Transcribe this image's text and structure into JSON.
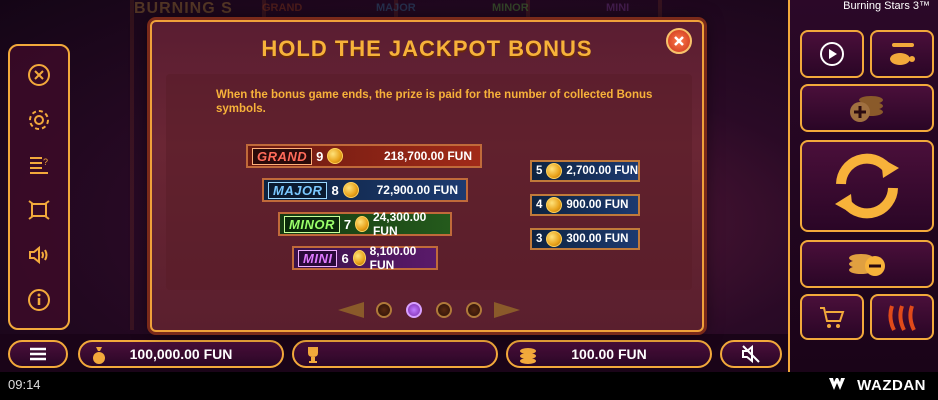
{
  "app": {
    "title": "Burning Stars 3™",
    "brand": "WAZDAN",
    "clock": "09:14"
  },
  "background": {
    "logo": "BURNING S",
    "tags": [
      "GRAND",
      "MAJOR",
      "MINOR",
      "MINI"
    ]
  },
  "modal": {
    "title": "HOLD THE JACKPOT BONUS",
    "description": "When the bonus game ends, the prize is paid for the number of collected Bonus symbols.",
    "jackpots": [
      {
        "tag": "GRAND",
        "count": "9",
        "value": "218,700.00 FUN"
      },
      {
        "tag": "MAJOR",
        "count": "8",
        "value": "72,900.00 FUN"
      },
      {
        "tag": "MINOR",
        "count": "7",
        "value": "24,300.00 FUN"
      },
      {
        "tag": "MINI",
        "count": "6",
        "value": "8,100.00 FUN"
      }
    ],
    "small_prizes": [
      {
        "count": "5",
        "value": "2,700.00 FUN"
      },
      {
        "count": "4",
        "value": "900.00 FUN"
      },
      {
        "count": "3",
        "value": "300.00 FUN"
      }
    ],
    "pager": {
      "pages": 4,
      "active_index": 1
    }
  },
  "bottom": {
    "balance": "100,000.00 FUN",
    "win": "",
    "bet": "100.00 FUN"
  },
  "colors": {
    "accent": "#f2a93b",
    "title_gold": "#f7b23a"
  },
  "icons": {
    "left": [
      "close-icon",
      "settings-gear-icon",
      "paytable-icon",
      "fullscreen-icon",
      "sound-icon",
      "info-icon"
    ],
    "right": [
      "autoplay-icon",
      "turbo-turtle-icon",
      "bet-increase-icon",
      "spin-icon",
      "bet-decrease-icon",
      "buy-feature-icon",
      "volatility-chili-icon"
    ]
  }
}
